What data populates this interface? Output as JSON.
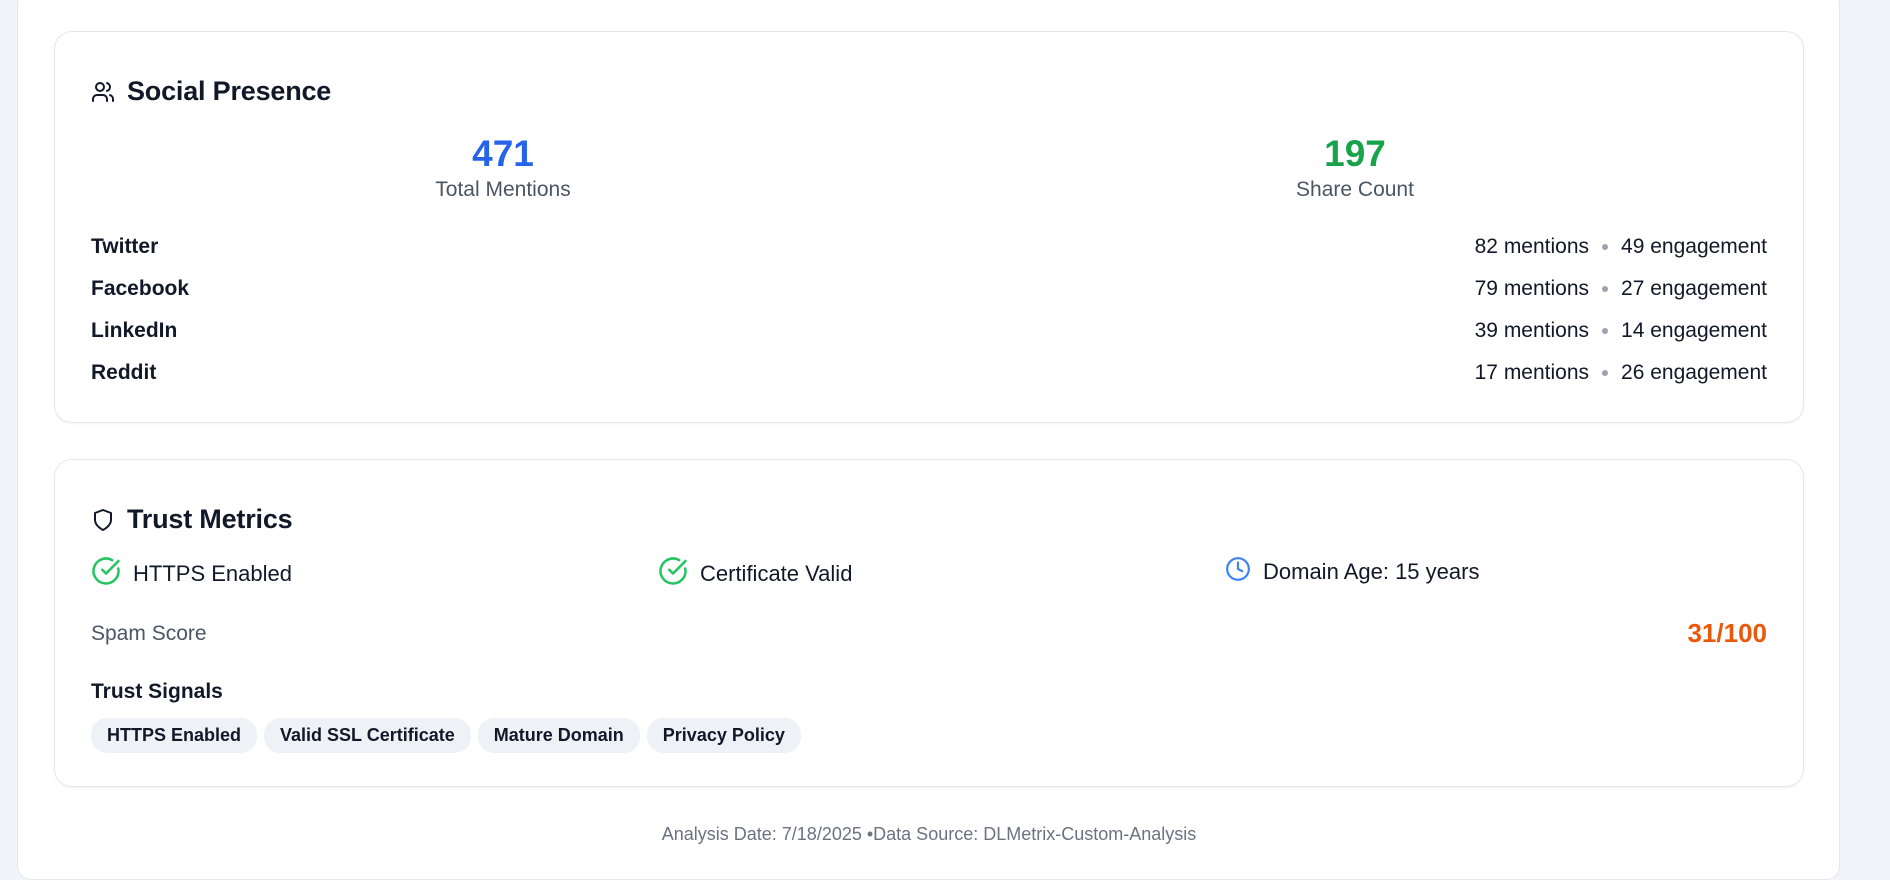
{
  "social": {
    "title": "Social Presence",
    "total_mentions": {
      "value": "471",
      "label": "Total Mentions",
      "color": "#2563eb"
    },
    "share_count": {
      "value": "197",
      "label": "Share Count",
      "color": "#16a34a"
    },
    "platforms": [
      {
        "name": "Twitter",
        "mentions": "82 mentions",
        "engagement": "49 engagement"
      },
      {
        "name": "Facebook",
        "mentions": "79 mentions",
        "engagement": "27 engagement"
      },
      {
        "name": "LinkedIn",
        "mentions": "39 mentions",
        "engagement": "14 engagement"
      },
      {
        "name": "Reddit",
        "mentions": "17 mentions",
        "engagement": "26 engagement"
      }
    ]
  },
  "trust": {
    "title": "Trust Metrics",
    "https": "HTTPS Enabled",
    "certificate": "Certificate Valid",
    "domain_age": "Domain Age: 15 years",
    "spam_label": "Spam Score",
    "spam_value": "31/100",
    "signals_heading": "Trust Signals",
    "signals": [
      "HTTPS Enabled",
      "Valid SSL Certificate",
      "Mature Domain",
      "Privacy Policy"
    ]
  },
  "footer": {
    "text": "Analysis Date: 7/18/2025 •Data Source: DLMetrix-Custom-Analysis"
  },
  "icons": {
    "social": "users-icon",
    "trust": "shield-icon",
    "check": "check-circle-icon",
    "clock": "clock-icon"
  },
  "colors": {
    "accent_blue": "#2563eb",
    "accent_green": "#16a34a",
    "check_green": "#22c55e",
    "spam_orange": "#ea580c"
  }
}
